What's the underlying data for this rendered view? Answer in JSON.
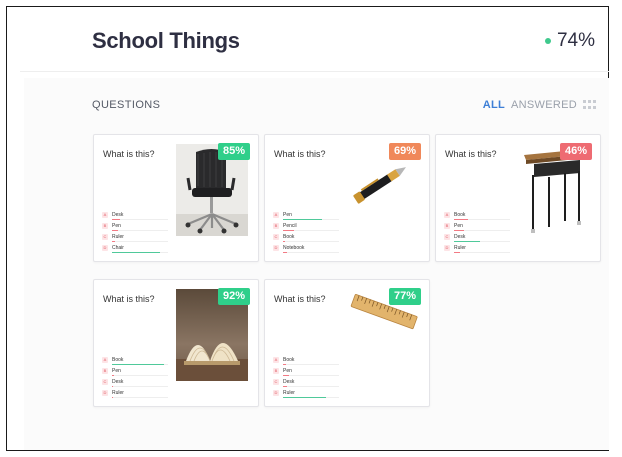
{
  "header": {
    "title": "School Things",
    "score": "74%",
    "score_color": "#3fc98d"
  },
  "section": {
    "label": "QUESTIONS"
  },
  "filters": {
    "all": "ALL",
    "answered": "ANSWERED",
    "grid_icon": "grid-view-icon"
  },
  "badge_colors": {
    "green": "#2fcf8a",
    "orange": "#f0885a",
    "red": "#ee6b72"
  },
  "cards": [
    {
      "question": "What is this?",
      "percent": "85%",
      "image": "office-chair",
      "answers": [
        {
          "letter": "A",
          "text": "Desk",
          "fill": 0.15
        },
        {
          "letter": "B",
          "text": "Pen",
          "fill": 0.1
        },
        {
          "letter": "C",
          "text": "Ruler",
          "fill": 0.05
        },
        {
          "letter": "D",
          "text": "Chair",
          "fill": 0.85,
          "correct": true
        }
      ]
    },
    {
      "question": "What is this?",
      "percent": "69%",
      "image": "pen",
      "answers": [
        {
          "letter": "A",
          "text": "Pen",
          "fill": 0.69,
          "correct": true
        },
        {
          "letter": "B",
          "text": "Pencil",
          "fill": 0.2
        },
        {
          "letter": "C",
          "text": "Book",
          "fill": 0.04
        },
        {
          "letter": "D",
          "text": "Notebook",
          "fill": 0.07
        }
      ]
    },
    {
      "question": "What is this?",
      "percent": "46%",
      "image": "school-desk",
      "answers": [
        {
          "letter": "A",
          "text": "Book",
          "fill": 0.25
        },
        {
          "letter": "B",
          "text": "Pen",
          "fill": 0.18
        },
        {
          "letter": "C",
          "text": "Desk",
          "fill": 0.46,
          "correct": true
        },
        {
          "letter": "D",
          "text": "Ruler",
          "fill": 0.11
        }
      ]
    },
    {
      "question": "What is this?",
      "percent": "92%",
      "image": "open-book",
      "answers": [
        {
          "letter": "A",
          "text": "Book",
          "fill": 0.92,
          "correct": true
        },
        {
          "letter": "B",
          "text": "Pen",
          "fill": 0.04
        },
        {
          "letter": "C",
          "text": "Desk",
          "fill": 0.02
        },
        {
          "letter": "D",
          "text": "Ruler",
          "fill": 0.02
        }
      ]
    },
    {
      "question": "What is this?",
      "percent": "77%",
      "image": "wooden-ruler",
      "answers": [
        {
          "letter": "A",
          "text": "Book",
          "fill": 0.05
        },
        {
          "letter": "B",
          "text": "Pen",
          "fill": 0.1
        },
        {
          "letter": "C",
          "text": "Desk",
          "fill": 0.08
        },
        {
          "letter": "D",
          "text": "Ruler",
          "fill": 0.77,
          "correct": true
        }
      ]
    }
  ]
}
